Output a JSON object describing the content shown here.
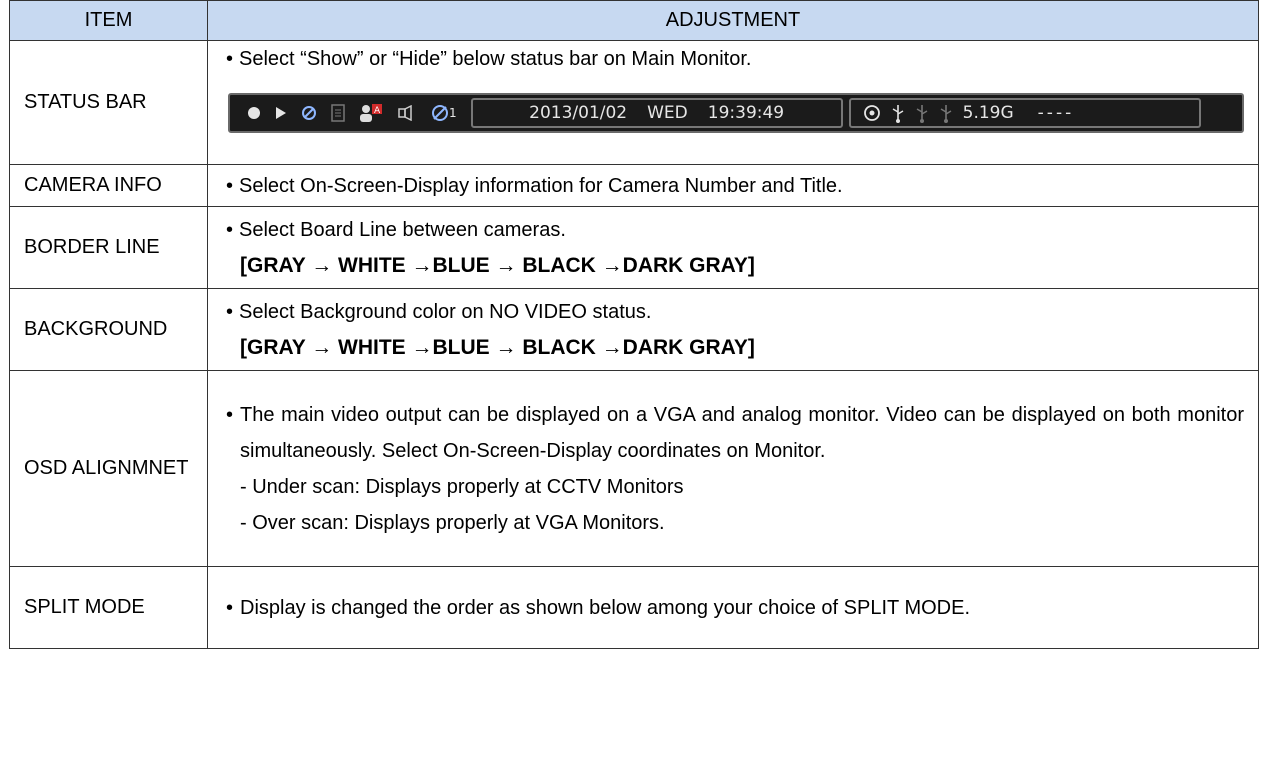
{
  "header": {
    "item": "ITEM",
    "adjustment": "ADJUSTMENT"
  },
  "rows": {
    "status_bar": {
      "item": "STATUS BAR",
      "line1": "Select “Show” or “Hide” below status bar on Main Monitor.",
      "status_bar_graphic": {
        "date": "2013/01/02",
        "day": "WED",
        "time": "19:39:49",
        "storage": "5.19G",
        "tail": "----",
        "sub_index": "1"
      }
    },
    "camera_info": {
      "item": "CAMERA INFO",
      "line1": "Select On-Screen-Display information for Camera Number and Title."
    },
    "border_line": {
      "item": "BORDER LINE",
      "line1": "Select Board Line between cameras.",
      "sequence": "[GRAY → WHITE →BLUE → BLACK →DARK GRAY]"
    },
    "background": {
      "item": "BACKGROUND",
      "line1": "Select Background color on NO VIDEO status.",
      "sequence": "[GRAY → WHITE →BLUE → BLACK →DARK GRAY]"
    },
    "osd_alignment": {
      "item": "OSD ALIGNMNET",
      "para": "The main video output can be displayed on a VGA and analog monitor. Video can be displayed on both monitor simultaneously. Select On-Screen-Display coordinates on Monitor.",
      "under": "- Under scan: Displays properly at CCTV Monitors",
      "over": "- Over scan: Displays properly at VGA Monitors."
    },
    "split_mode": {
      "item": "SPLIT MODE",
      "para": "Display is changed the order as shown below among your choice of SPLIT MODE."
    }
  },
  "colors": {
    "header_bg": "#c7d9f1",
    "border": "#333333"
  }
}
